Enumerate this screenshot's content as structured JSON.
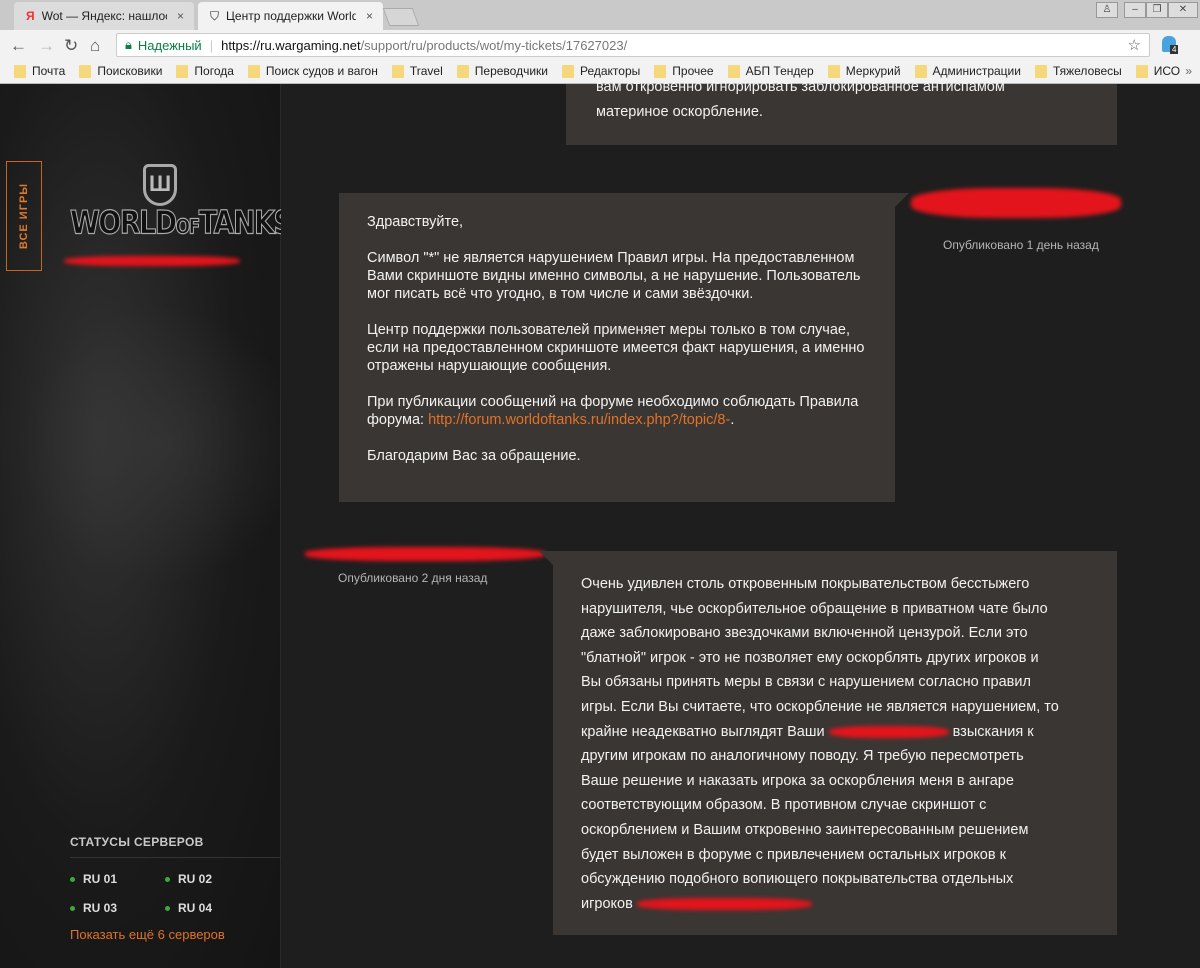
{
  "browser": {
    "tabs": [
      {
        "icon": "Я",
        "title": "Wot — Яндекс: нашлось",
        "close": "×"
      },
      {
        "icon": "⛉",
        "title": "Центр поддержки World",
        "close": "×"
      }
    ],
    "secure_label": "Надежный",
    "url_host": "https://ru.wargaming.net",
    "url_path": "/support/ru/products/wot/my-tickets/17627023/",
    "extension_badge": "4",
    "bookmarks": [
      "Почта",
      "Поисковики",
      "Погода",
      "Поиск судов и вагон",
      "Travel",
      "Переводчики",
      "Редакторы",
      "Прочее",
      "АБП Тендер",
      "Меркурий",
      "Администрации",
      "Тяжеловесы",
      "ИСО"
    ],
    "bookmarks_more": "»"
  },
  "sidebar": {
    "all_games": "ВСЕ ИГРЫ",
    "logo_text": "WORLD of TANKS",
    "servers_title": "СТАТУСЫ СЕРВЕРОВ",
    "servers": [
      "RU 01",
      "RU 02",
      "RU 03",
      "RU 04"
    ],
    "status_color": "#3fa83f",
    "show_more": "Показать ещё 6 серверов"
  },
  "messages": {
    "prev": {
      "lines": [
        "вам откровенно игнорировать заблокированное антиспамом",
        "материное оскорбление."
      ]
    },
    "support": {
      "published": "Опубликовано 1 день назад",
      "greeting": "Здравствуйте,",
      "p1": "Символ \"*\" не является нарушением Правил игры. На предоставленном Вами скриншоте видны именно символы, а не нарушение. Пользователь мог писать всё что угодно, в том числе и сами звёздочки.",
      "p2": "Центр поддержки пользователей применяет меры только в том случае, если на предоставленном скриншоте имеется факт нарушения, а именно отражены нарушающие сообщения.",
      "p3": "При публикации сообщений на форуме необходимо соблюдать Правила форума:",
      "p3_link": "http://forum.worldoftanks.ru/index.php?/topic/8-",
      "p3_end": ".",
      "p4": "Благодарим Вас за обращение."
    },
    "user": {
      "published": "Опубликовано 2 дня назад",
      "lines": [
        "Очень удивлен столь откровенным покрывательством бесстыжего",
        "нарушителя, чье оскорбительное обращение в приватном чате было",
        "даже заблокировано звездочками включенной цензурой. Если это",
        "\"блатной\" игрок - это не позволяет ему оскорблять других игроков и",
        "Вы обязаны принять меры в связи с нарушением согласно правил",
        "игры. Если Вы считаете, что оскорбление не является нарушением, то",
        "крайне неадекватно выглядят Ваши",
        "взыскания к",
        "другим игрокам по аналогичному поводу. Я требую пересмотреть",
        "Ваше решение и наказать игрока за оскорбления меня в ангаре",
        "соответствующим образом. В противном случае скриншот с",
        "оскорблением и Вашим откровенно заинтересованным решением",
        "будет выложен в форуме с привлечением остальных игроков к",
        "обсуждению подобного вопиющего покрывательства отдельных",
        "игроков"
      ]
    }
  },
  "colors": {
    "accent": "#e0722a",
    "box": "#3a3633",
    "redaction": "#e4141c"
  }
}
